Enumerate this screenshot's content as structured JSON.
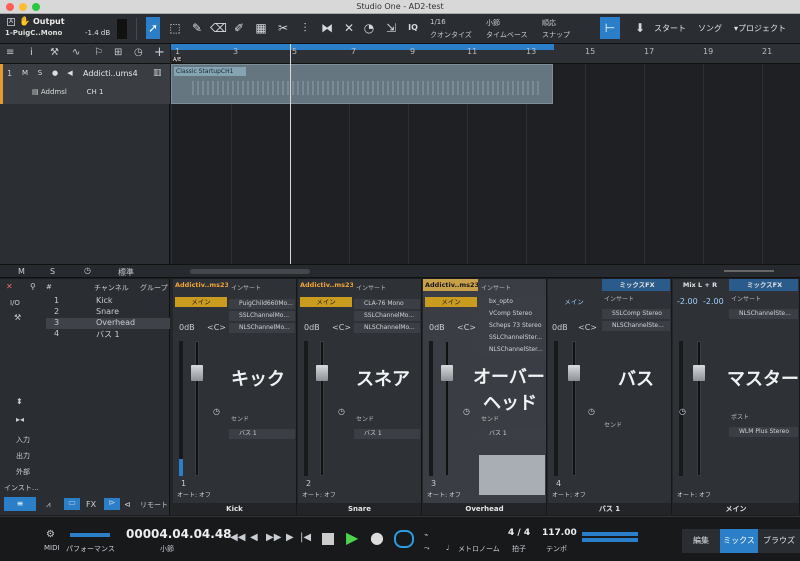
{
  "window": {
    "title": "Studio One - AD2-test"
  },
  "toolbar": {
    "output_label": "Output",
    "output_track": "1-PuigC..Mono",
    "output_db": "-1.4 dB",
    "quantize_value": "1/16",
    "quantize_label": "クオンタイズ",
    "timebase_value": "小節",
    "timebase_label": "タイムベース",
    "snap_value": "順応",
    "snap_label": "スナップ",
    "iq_label": "IQ",
    "start_label": "スタート",
    "song_label": "ソング",
    "project_label": "プロジェクト"
  },
  "track": {
    "number": "1",
    "m": "M",
    "s": "S",
    "name": "Addicti..ums4",
    "instrument": "Addmsl",
    "channel": "CH 1"
  },
  "ruler": {
    "bars": [
      "1",
      "3",
      "5",
      "7",
      "9",
      "11",
      "13",
      "15",
      "17",
      "19",
      "21"
    ]
  },
  "clip": {
    "name": "Classic StartupCH1",
    "marker": "A/E"
  },
  "arrange_status": {
    "m": "M",
    "s": "S",
    "label": "標準"
  },
  "mixer": {
    "io_label": "I/O",
    "header_number": "#",
    "header_channel": "チャンネル",
    "header_group": "グループ",
    "channels": [
      {
        "n": "1",
        "name": "Kick"
      },
      {
        "n": "2",
        "name": "Snare"
      },
      {
        "n": "3",
        "name": "Overhead"
      },
      {
        "n": "4",
        "name": "バス 1"
      }
    ],
    "left_nav": [
      "入力",
      "出力",
      "外部",
      "インスト..."
    ],
    "remote_label": "リモート",
    "insert_label": "インサート",
    "send_label": "センド",
    "main_label": "メイン",
    "bus_label": "バス 1",
    "odb": "0dB",
    "center": "<C>",
    "auto_off": "オート: オフ",
    "strips": [
      {
        "title": "Addictiv..ms23",
        "inserts": [
          "PuigChild660Mo...",
          "SSLChannelMo...",
          "NLSChannelMo..."
        ],
        "big": "キック",
        "num": "1",
        "name": "Kick"
      },
      {
        "title": "Addictiv..ms23",
        "inserts": [
          "CLA-76 Mono",
          "SSLChannelMo...",
          "NLSChannelMo..."
        ],
        "big": "スネア",
        "num": "2",
        "name": "Snare"
      },
      {
        "title": "Addictiv..ms23",
        "inserts": [
          "bx_opto",
          "VComp Stereo",
          "Scheps 73 Stereo",
          "SSLChannelSter...",
          "NLSChannelSter..."
        ],
        "big": "オーバー",
        "big2": "ヘッド",
        "num": "3",
        "name": "Overhead"
      },
      {
        "title": "",
        "inserts": [],
        "big": "",
        "num": "4",
        "name": ""
      },
      {
        "title": "ミックスFX",
        "inserts": [
          "SSLComp Stereo",
          "NLSChannelSte..."
        ],
        "big": "バス",
        "num": "",
        "name": "バス 1"
      },
      {
        "title": "Mix L + R",
        "inserts": [],
        "big": "",
        "num": "",
        "name": ""
      },
      {
        "title": "ミックスFX",
        "inserts": [
          "NLSChannelSte..."
        ],
        "big": "マスター",
        "post_label": "ポスト",
        "post_insert": "WLM Plus Stereo",
        "name": "メイン"
      }
    ],
    "master_db_l": "-2.00",
    "master_db_r": "-2.00"
  },
  "transport": {
    "midi_label": "MIDI",
    "performance_label": "パフォーマンス",
    "time": "00004.04.04.48",
    "time_unit": "小節",
    "metronome_label": "メトロノーム",
    "signature": "4 / 4",
    "signature_label": "拍子",
    "tempo": "117.00",
    "tempo_label": "テンポ",
    "edit_label": "編集",
    "mix_label": "ミックス",
    "browse_label": "ブラウズ"
  }
}
